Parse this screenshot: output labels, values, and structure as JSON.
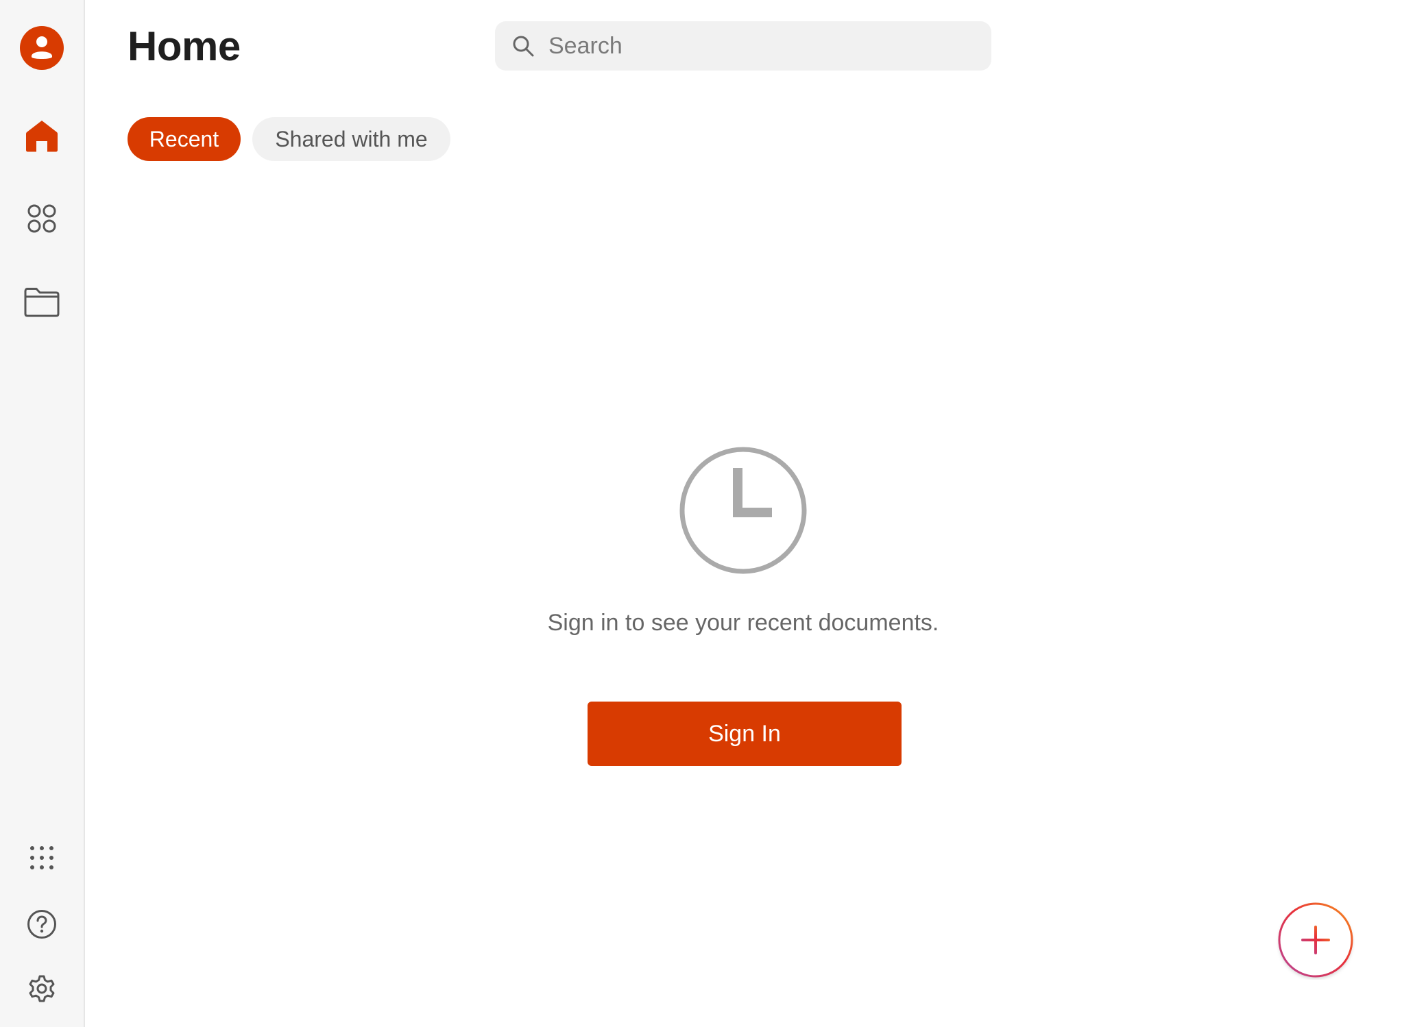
{
  "header": {
    "title": "Home"
  },
  "search": {
    "placeholder": "Search",
    "value": ""
  },
  "tabs": [
    {
      "label": "Recent",
      "active": true
    },
    {
      "label": "Shared with me",
      "active": false
    }
  ],
  "sidebar": {
    "items": [
      {
        "icon": "account-icon",
        "label": "Account"
      },
      {
        "icon": "home-icon",
        "label": "Home",
        "active": true
      },
      {
        "icon": "apps-icon",
        "label": "Apps"
      },
      {
        "icon": "folder-icon",
        "label": "Files"
      },
      {
        "icon": "more-apps-icon",
        "label": "More"
      },
      {
        "icon": "help-icon",
        "label": "Help"
      },
      {
        "icon": "settings-icon",
        "label": "Settings"
      }
    ]
  },
  "empty_state": {
    "icon": "clock-icon",
    "message": "Sign in to see your recent documents.",
    "button_label": "Sign In"
  },
  "fab": {
    "icon": "plus-icon"
  },
  "colors": {
    "accent": "#d83b01",
    "sidebar_bg": "#f6f6f6",
    "muted_text": "#666666",
    "icon_gray": "#555555",
    "clock_gray": "#aaaaaa"
  }
}
